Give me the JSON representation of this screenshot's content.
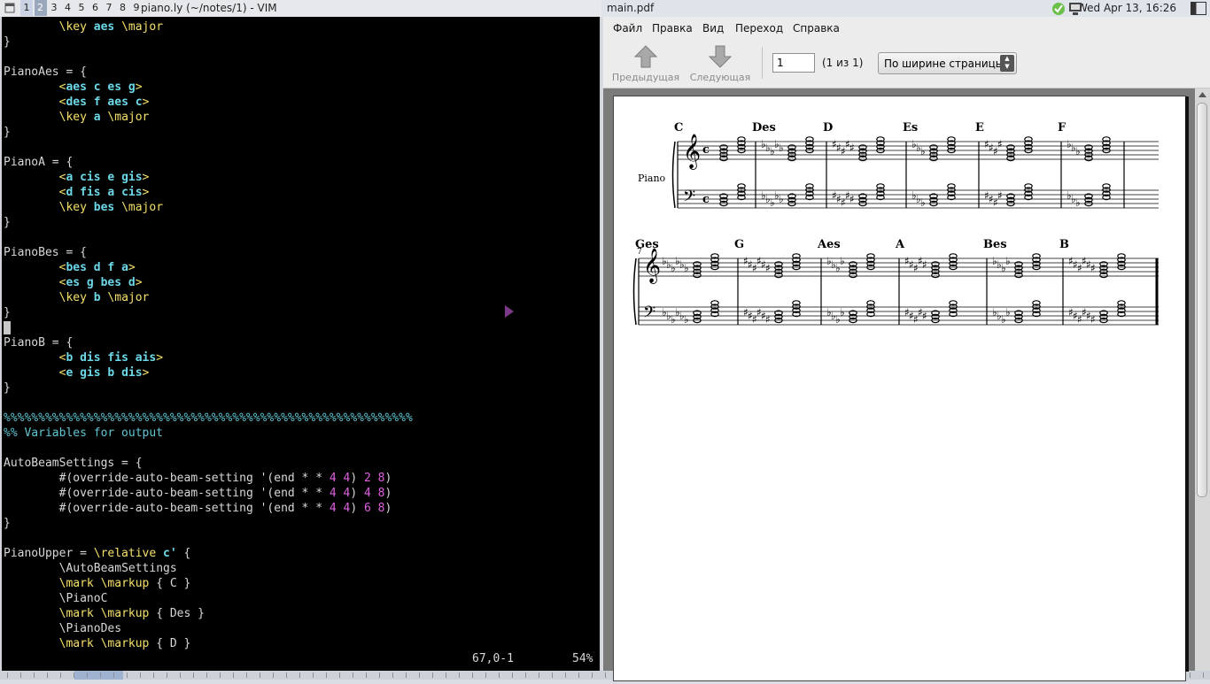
{
  "taskbar": {
    "workspaces": [
      "1",
      "2",
      "3",
      "4",
      "5",
      "6",
      "7",
      "8",
      "9"
    ],
    "active_workspace": "1",
    "clock": "Wed Apr 13, 16:26",
    "tray_icons": [
      "network-ok-icon",
      "computer-icon",
      "panel-toggle-icon"
    ]
  },
  "vim": {
    "title": "piano.ly (~/notes/1) - VIM",
    "status_position": "67,0-1",
    "status_percent": "54%",
    "lines": [
      {
        "indent": true,
        "tokens": [
          {
            "t": "\\key ",
            "c": "kw"
          },
          {
            "t": "aes",
            "c": "nt"
          },
          {
            "t": " \\major",
            "c": "kw"
          }
        ]
      },
      {
        "tokens": [
          {
            "t": "}",
            "c": ""
          }
        ]
      },
      {
        "tokens": []
      },
      {
        "tokens": [
          {
            "t": "PianoAes = {",
            "c": ""
          }
        ]
      },
      {
        "indent": true,
        "tokens": [
          {
            "t": "<",
            "c": "kw"
          },
          {
            "t": "aes c es g",
            "c": "nt"
          },
          {
            "t": ">",
            "c": "kw"
          }
        ]
      },
      {
        "indent": true,
        "tokens": [
          {
            "t": "<",
            "c": "kw"
          },
          {
            "t": "des f aes c",
            "c": "nt"
          },
          {
            "t": ">",
            "c": "kw"
          }
        ]
      },
      {
        "indent": true,
        "tokens": [
          {
            "t": "\\key ",
            "c": "kw"
          },
          {
            "t": "a",
            "c": "nt"
          },
          {
            "t": " \\major",
            "c": "kw"
          }
        ]
      },
      {
        "tokens": [
          {
            "t": "}",
            "c": ""
          }
        ]
      },
      {
        "tokens": []
      },
      {
        "tokens": [
          {
            "t": "PianoA = {",
            "c": ""
          }
        ]
      },
      {
        "indent": true,
        "tokens": [
          {
            "t": "<",
            "c": "kw"
          },
          {
            "t": "a cis e gis",
            "c": "nt"
          },
          {
            "t": ">",
            "c": "kw"
          }
        ]
      },
      {
        "indent": true,
        "tokens": [
          {
            "t": "<",
            "c": "kw"
          },
          {
            "t": "d fis a cis",
            "c": "nt"
          },
          {
            "t": ">",
            "c": "kw"
          }
        ]
      },
      {
        "indent": true,
        "tokens": [
          {
            "t": "\\key ",
            "c": "kw"
          },
          {
            "t": "bes",
            "c": "nt"
          },
          {
            "t": " \\major",
            "c": "kw"
          }
        ]
      },
      {
        "tokens": [
          {
            "t": "}",
            "c": ""
          }
        ]
      },
      {
        "tokens": []
      },
      {
        "tokens": [
          {
            "t": "PianoBes = {",
            "c": ""
          }
        ]
      },
      {
        "indent": true,
        "tokens": [
          {
            "t": "<",
            "c": "kw"
          },
          {
            "t": "bes d f a",
            "c": "nt"
          },
          {
            "t": ">",
            "c": "kw"
          }
        ]
      },
      {
        "indent": true,
        "tokens": [
          {
            "t": "<",
            "c": "kw"
          },
          {
            "t": "es g bes d",
            "c": "nt"
          },
          {
            "t": ">",
            "c": "kw"
          }
        ]
      },
      {
        "indent": true,
        "tokens": [
          {
            "t": "\\key ",
            "c": "kw"
          },
          {
            "t": "b",
            "c": "nt"
          },
          {
            "t": " \\major",
            "c": "kw"
          }
        ]
      },
      {
        "tokens": [
          {
            "t": "}",
            "c": ""
          }
        ]
      },
      {
        "tokens": [
          {
            "t": " ",
            "c": "cursor"
          }
        ]
      },
      {
        "tokens": [
          {
            "t": "PianoB = {",
            "c": ""
          }
        ]
      },
      {
        "indent": true,
        "tokens": [
          {
            "t": "<",
            "c": "kw"
          },
          {
            "t": "b dis fis ais",
            "c": "nt"
          },
          {
            "t": ">",
            "c": "kw"
          }
        ]
      },
      {
        "indent": true,
        "tokens": [
          {
            "t": "<",
            "c": "kw"
          },
          {
            "t": "e gis b dis",
            "c": "nt"
          },
          {
            "t": ">",
            "c": "kw"
          }
        ]
      },
      {
        "tokens": [
          {
            "t": "}",
            "c": ""
          }
        ]
      },
      {
        "tokens": []
      },
      {
        "tokens": [
          {
            "t": "%%%%%%%%%%%%%%%%%%%%%%%%%%%%%%%%%%%%%%%%%%%%%%%%%%%%%%%%%%%",
            "c": "cm"
          }
        ]
      },
      {
        "tokens": [
          {
            "t": "%% Variables for output",
            "c": "cm"
          }
        ]
      },
      {
        "tokens": []
      },
      {
        "tokens": [
          {
            "t": "AutoBeamSettings = {",
            "c": ""
          }
        ]
      },
      {
        "indent": true,
        "tokens": [
          {
            "t": "#(override-auto-beam-setting '(end * * ",
            "c": ""
          },
          {
            "t": "4 4",
            "c": "nm"
          },
          {
            "t": ") ",
            "c": ""
          },
          {
            "t": "2 8",
            "c": "nm"
          },
          {
            "t": ")",
            "c": ""
          }
        ]
      },
      {
        "indent": true,
        "tokens": [
          {
            "t": "#(override-auto-beam-setting '(end * * ",
            "c": ""
          },
          {
            "t": "4 4",
            "c": "nm"
          },
          {
            "t": ") ",
            "c": ""
          },
          {
            "t": "4 8",
            "c": "nm"
          },
          {
            "t": ")",
            "c": ""
          }
        ]
      },
      {
        "indent": true,
        "tokens": [
          {
            "t": "#(override-auto-beam-setting '(end * * ",
            "c": ""
          },
          {
            "t": "4 4",
            "c": "nm"
          },
          {
            "t": ") ",
            "c": ""
          },
          {
            "t": "6 8",
            "c": "nm"
          },
          {
            "t": ")",
            "c": ""
          }
        ]
      },
      {
        "tokens": [
          {
            "t": "}",
            "c": ""
          }
        ]
      },
      {
        "tokens": []
      },
      {
        "tokens": [
          {
            "t": "PianoUpper = ",
            "c": ""
          },
          {
            "t": "\\relative ",
            "c": "kw"
          },
          {
            "t": "c'",
            "c": "nt"
          },
          {
            "t": " {",
            "c": ""
          }
        ]
      },
      {
        "indent": true,
        "tokens": [
          {
            "t": "\\AutoBeamSettings",
            "c": ""
          }
        ]
      },
      {
        "indent": true,
        "tokens": [
          {
            "t": "\\mark \\markup",
            "c": "kw"
          },
          {
            "t": " { C }",
            "c": ""
          }
        ]
      },
      {
        "indent": true,
        "tokens": [
          {
            "t": "\\PianoC",
            "c": ""
          }
        ]
      },
      {
        "indent": true,
        "tokens": [
          {
            "t": "\\mark \\markup",
            "c": "kw"
          },
          {
            "t": " { Des }",
            "c": ""
          }
        ]
      },
      {
        "indent": true,
        "tokens": [
          {
            "t": "\\PianoDes",
            "c": ""
          }
        ]
      },
      {
        "indent": true,
        "tokens": [
          {
            "t": "\\mark \\markup",
            "c": "kw"
          },
          {
            "t": " { D }",
            "c": ""
          }
        ]
      }
    ]
  },
  "pdf": {
    "title": "main.pdf",
    "menu": [
      "Файл",
      "Правка",
      "Вид",
      "Переход",
      "Справка"
    ],
    "prev_label": "Предыдущая",
    "next_label": "Следующая",
    "page_value": "1",
    "page_count": "(1 из 1)",
    "zoom_value": "По ширине страницы",
    "score": {
      "instrument": "Piano",
      "measure_number": "7",
      "system1_marks": [
        "C",
        "Des",
        "D",
        "Es",
        "E",
        "F"
      ],
      "system2_marks": [
        "Ges",
        "G",
        "Aes",
        "A",
        "Bes",
        "B"
      ]
    }
  }
}
